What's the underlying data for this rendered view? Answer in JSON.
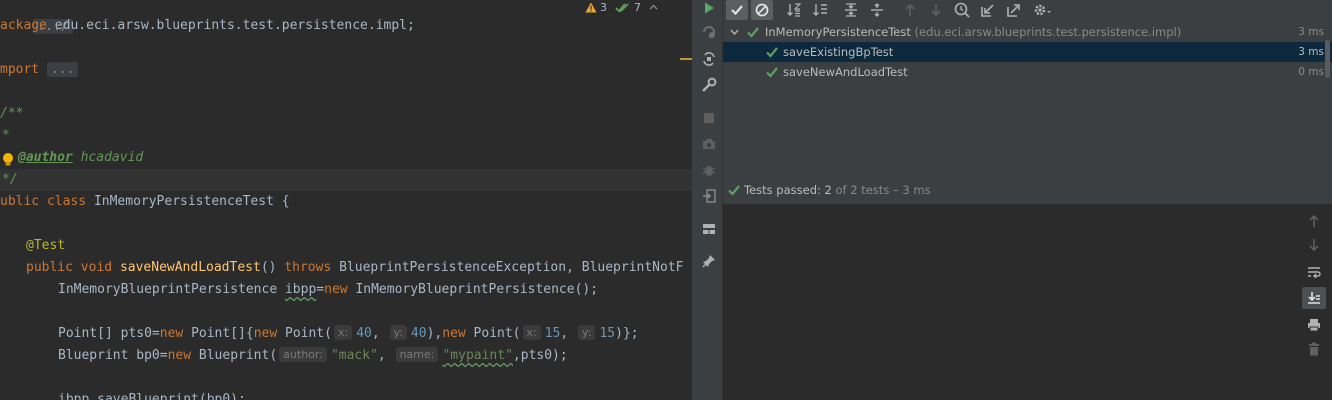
{
  "editor": {
    "inspections": {
      "warnings": "3",
      "weak_warnings": "7"
    },
    "lines": {
      "breadcrumb": ".../",
      "package_kw": "ackage",
      "package_name": " edu.eci.arsw.blueprints.test.persistence.impl;",
      "import_kw": "mport",
      "import_fold": "...",
      "doc_open": "/**",
      "doc_star": "*",
      "author_tag": "@author",
      "author_name": "hcadavid",
      "doc_close": "*/",
      "class_public": "ublic",
      "class_kw": "class",
      "class_name": "InMemoryPersistenceTest {",
      "annotation": "@Test",
      "method_public": "public",
      "method_void": "void",
      "method_name": "saveNewAndLoadTest",
      "method_parens": "()",
      "method_throws": "throws",
      "method_exceptions": "BlueprintPersistenceException, BlueprintNotF",
      "ibpp_type": "InMemoryBlueprintPersistence",
      "ibpp_var": "ibpp",
      "ibpp_eq": "=",
      "ibpp_new": "new",
      "ibpp_rest": "InMemoryBlueprintPersistence();",
      "pts_decl": "Point[] pts0=",
      "pts_new1": "new",
      "pts_arr": "Point[]{",
      "pts_new2": "new",
      "pts_point1": "Point(",
      "hint_x": "x:",
      "hint_y": "y:",
      "val_40a": "40",
      "val_40b": "40",
      "pts_comma1": "),",
      "pts_new3": "new",
      "pts_point2": "Point(",
      "val_15a": "15",
      "val_15b": "15",
      "pts_end": ")};",
      "bp_decl": "Blueprint bp0=",
      "bp_new": "new",
      "bp_ctor": "Blueprint(",
      "hint_author": "author:",
      "str_mack": "\"mack\"",
      "hint_name": "name:",
      "str_mypaint": "\"mypaint\"",
      "bp_end": ",pts0);",
      "save_call": "ibpp.saveBlueprint(bp0);"
    }
  },
  "run_panel": {
    "tree": {
      "root": {
        "name": "InMemoryPersistenceTest",
        "package": "(edu.eci.arsw.blueprints.test.persistence.impl)",
        "time": "3 ms"
      },
      "items": [
        {
          "name": "saveExistingBpTest",
          "time": "3 ms"
        },
        {
          "name": "saveNewAndLoadTest",
          "time": "0 ms"
        }
      ]
    },
    "status": {
      "prefix": "Tests passed:",
      "count": "2",
      "suffix": "of 2 tests – 3 ms"
    }
  },
  "colors": {
    "pass_green": "#5fa05f",
    "keyword": "#cc7832",
    "function": "#ffc66d",
    "string": "#6a8759",
    "number": "#6897bb",
    "selection": "#0d293e"
  },
  "icons": {
    "left_toolbar": [
      "run-icon",
      "rerun-failed-icon",
      "toggle-autotest-icon",
      "wrench-icon",
      "stop-icon",
      "camera-icon",
      "debug-icon",
      "exit-icon",
      "layout-icon",
      "pin-icon"
    ],
    "top_toolbar": [
      "show-passed-icon",
      "show-ignored-icon",
      "sort-alpha-icon",
      "sort-duration-icon",
      "expand-all-icon",
      "collapse-all-icon",
      "prev-failed-icon",
      "next-failed-icon",
      "history-icon",
      "import-icon",
      "export-icon",
      "settings-icon"
    ],
    "console_toolbar": [
      "scroll-up-icon",
      "scroll-down-icon",
      "soft-wrap-icon",
      "scroll-to-end-icon",
      "print-icon",
      "trash-icon"
    ]
  }
}
